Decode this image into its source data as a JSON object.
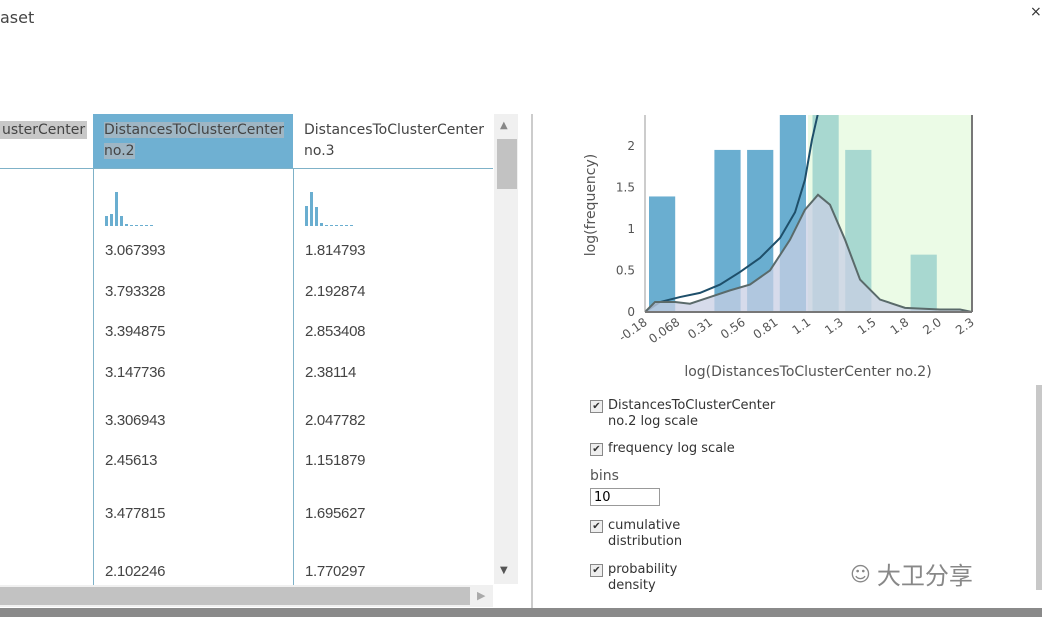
{
  "window": {
    "title": "aset",
    "close_label": "×"
  },
  "table": {
    "columns": [
      "usterCenter",
      "DistancesToClusterCenter no.2",
      "DistancesToClusterCenter no.3"
    ],
    "col2_rows": [
      "3.067393",
      "3.793328",
      "3.394875",
      "3.147736",
      "3.306943",
      "2.45613",
      "3.477815",
      "2.102246"
    ],
    "col3_rows": [
      "1.814793",
      "2.192874",
      "2.853408",
      "2.38114",
      "2.047782",
      "1.151879",
      "1.695627",
      "1.770297"
    ],
    "col2_hist": [
      0.3,
      0.35,
      1,
      0.3,
      0.05,
      0,
      0,
      0,
      0.03,
      0
    ],
    "col3_hist": [
      0.6,
      1,
      0.55,
      0.1,
      0.03,
      0,
      0,
      0,
      0.03,
      0
    ]
  },
  "chart_data": {
    "type": "bar",
    "xlabel": "log(DistancesToClusterCenter no.2)",
    "ylabel": "log(frequency)",
    "xlim": [
      -0.18,
      2.3
    ],
    "ylim": [
      0,
      2.37
    ],
    "x_ticks": [
      "-0.18",
      "0.068",
      "0.31",
      "0.56",
      "0.81",
      "1.1",
      "1.3",
      "1.5",
      "1.8",
      "2.0",
      "2.3"
    ],
    "y_ticks": [
      "0",
      "0.5",
      "1",
      "1.5",
      "2"
    ],
    "bins": 10,
    "values": [
      1.39,
      0,
      1.95,
      1.95,
      2.64,
      2.56,
      1.95,
      0,
      0.69,
      0
    ],
    "highlight_from": 1.056,
    "colors": {
      "bar": "#6aaed0",
      "bar_highlighted": "#a8d8d0",
      "highlight_bg": "#ebfbe6",
      "density_fill": "#c8cfe4",
      "density_line": "#5a6a6a",
      "cumulative_line": "#1e4f6a"
    },
    "series": [
      {
        "kind": "cumulative",
        "x": [
          -0.18,
          -0.066,
          0.085,
          0.237,
          0.389,
          0.54,
          0.692,
          0.844,
          0.958,
          1.033,
          1.086,
          1.132
        ],
        "y": [
          0,
          0.12,
          0.18,
          0.23,
          0.33,
          0.48,
          0.65,
          0.89,
          1.2,
          1.59,
          2.07,
          2.39
        ]
      },
      {
        "kind": "density",
        "x": [
          -0.18,
          -0.104,
          0.048,
          0.161,
          0.313,
          0.465,
          0.616,
          0.768,
          0.92,
          1.033,
          1.132,
          1.223,
          1.337,
          1.451,
          1.602,
          1.792,
          2.057,
          2.209,
          2.3
        ],
        "y": [
          0,
          0.12,
          0.12,
          0.1,
          0.18,
          0.26,
          0.33,
          0.5,
          0.87,
          1.23,
          1.41,
          1.29,
          0.87,
          0.39,
          0.15,
          0.05,
          0.03,
          0.03,
          0
        ]
      }
    ]
  },
  "options": {
    "x_log": {
      "label": "DistancesToClusterCenter no.2 log scale",
      "checked": true
    },
    "freq_log": {
      "label": "frequency log scale",
      "checked": true
    },
    "bins_label": "bins",
    "bins_value": "10",
    "cumulative": {
      "label": "cumulative distribution",
      "checked": true
    },
    "density": {
      "label": "probability density",
      "checked": true
    },
    "check_mark": "✔"
  },
  "watermark": "大卫分享"
}
